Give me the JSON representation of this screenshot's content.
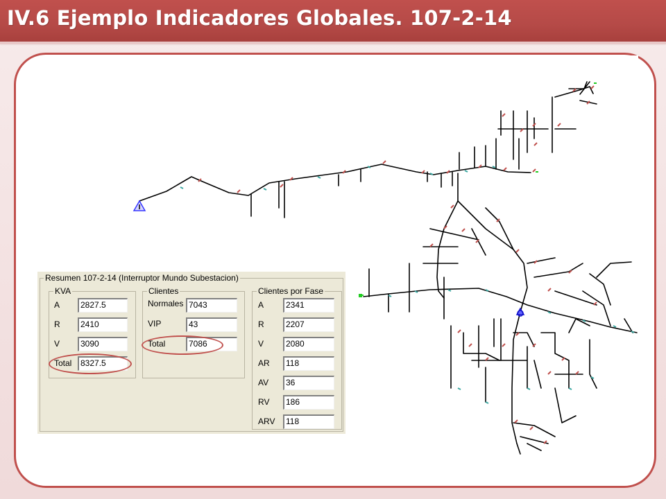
{
  "slide": {
    "title": "IV.6 Ejemplo Indicadores Globales. 107-2-14"
  },
  "colors": {
    "accent": "#c0504d",
    "panel_bg": "#ece9d8",
    "network_line": "#000000",
    "substation_marker": "#3333ff"
  },
  "map": {
    "icons": [
      "source-triangle-icon",
      "substation-marker-icon",
      "green-node-icon"
    ]
  },
  "resumen": {
    "title": "Resumen 107-2-14 (Interruptor Mundo Subestacion)",
    "kva": {
      "label": "KVA",
      "rows": [
        {
          "label": "A",
          "value": "2827.5"
        },
        {
          "label": "R",
          "value": "2410"
        },
        {
          "label": "V",
          "value": "3090"
        },
        {
          "label": "Total",
          "value": "8327.5"
        }
      ]
    },
    "clientes": {
      "label": "Clientes",
      "rows": [
        {
          "label": "Normales",
          "value": "7043"
        },
        {
          "label": "VIP",
          "value": "43"
        },
        {
          "label": "Total",
          "value": "7086"
        }
      ]
    },
    "fase": {
      "label": "Clientes por Fase",
      "rows": [
        {
          "label": "A",
          "value": "2341"
        },
        {
          "label": "R",
          "value": "2207"
        },
        {
          "label": "V",
          "value": "2080"
        },
        {
          "label": "AR",
          "value": "118"
        },
        {
          "label": "AV",
          "value": "36"
        },
        {
          "label": "RV",
          "value": "186"
        },
        {
          "label": "ARV",
          "value": "118"
        }
      ]
    }
  }
}
